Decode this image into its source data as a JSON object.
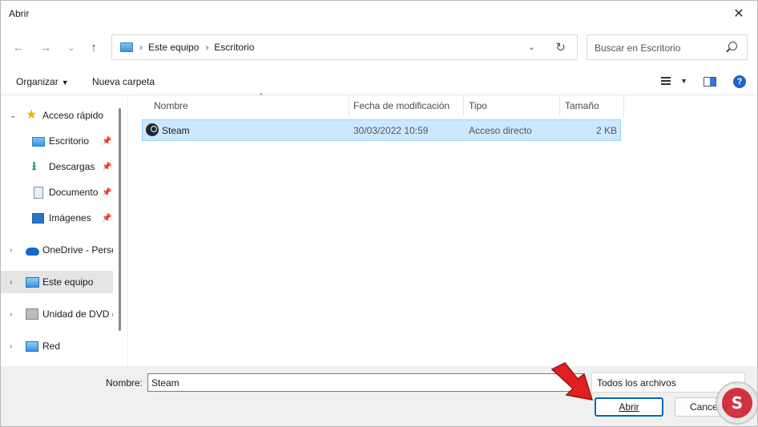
{
  "window": {
    "title": "Abrir"
  },
  "titlebar": {
    "close_glyph": "✕"
  },
  "nav": {
    "back": "←",
    "forward": "→",
    "recent": "⌄",
    "up": "↑"
  },
  "address": {
    "segments": [
      "Este equipo",
      "Escritorio"
    ],
    "separator": "›",
    "dropdown_glyph": "⌄",
    "refresh_glyph": "↻"
  },
  "search": {
    "placeholder": "Buscar en Escritorio"
  },
  "toolbar": {
    "organize_label": "Organizar",
    "new_folder_label": "Nueva carpeta",
    "help_glyph": "?"
  },
  "sidebar": {
    "items": [
      {
        "label": "Acceso rápido",
        "icon": "star-icon"
      },
      {
        "label": "Escritorio",
        "icon": "desktop-icon",
        "pinned": true
      },
      {
        "label": "Descargas",
        "icon": "download-icon",
        "pinned": true
      },
      {
        "label": "Documentos",
        "icon": "document-icon",
        "pinned": true
      },
      {
        "label": "Imágenes",
        "icon": "pictures-icon",
        "pinned": true
      },
      {
        "label": "OneDrive - Personal",
        "icon": "cloud-icon"
      },
      {
        "label": "Este equipo",
        "icon": "pc-icon",
        "selected": true
      },
      {
        "label": "Unidad de DVD (",
        "icon": "dvd-icon"
      },
      {
        "label": "Red",
        "icon": "network-icon"
      }
    ]
  },
  "columns": {
    "name": "Nombre",
    "modified": "Fecha de modificación",
    "type": "Tipo",
    "size": "Tamaño"
  },
  "files": [
    {
      "name": "Steam",
      "modified": "30/03/2022 10:59",
      "type": "Acceso directo",
      "size": "2 KB",
      "icon": "steam-icon",
      "selected": true
    }
  ],
  "bottom": {
    "filename_label": "Nombre:",
    "filename_value": "Steam",
    "filetype_value": "Todos los archivos",
    "open_label": "Abrir",
    "cancel_label": "Cancelar"
  },
  "colors": {
    "accent": "#0067c0",
    "selection": "#cce8ff",
    "arrow": "#e02020"
  }
}
